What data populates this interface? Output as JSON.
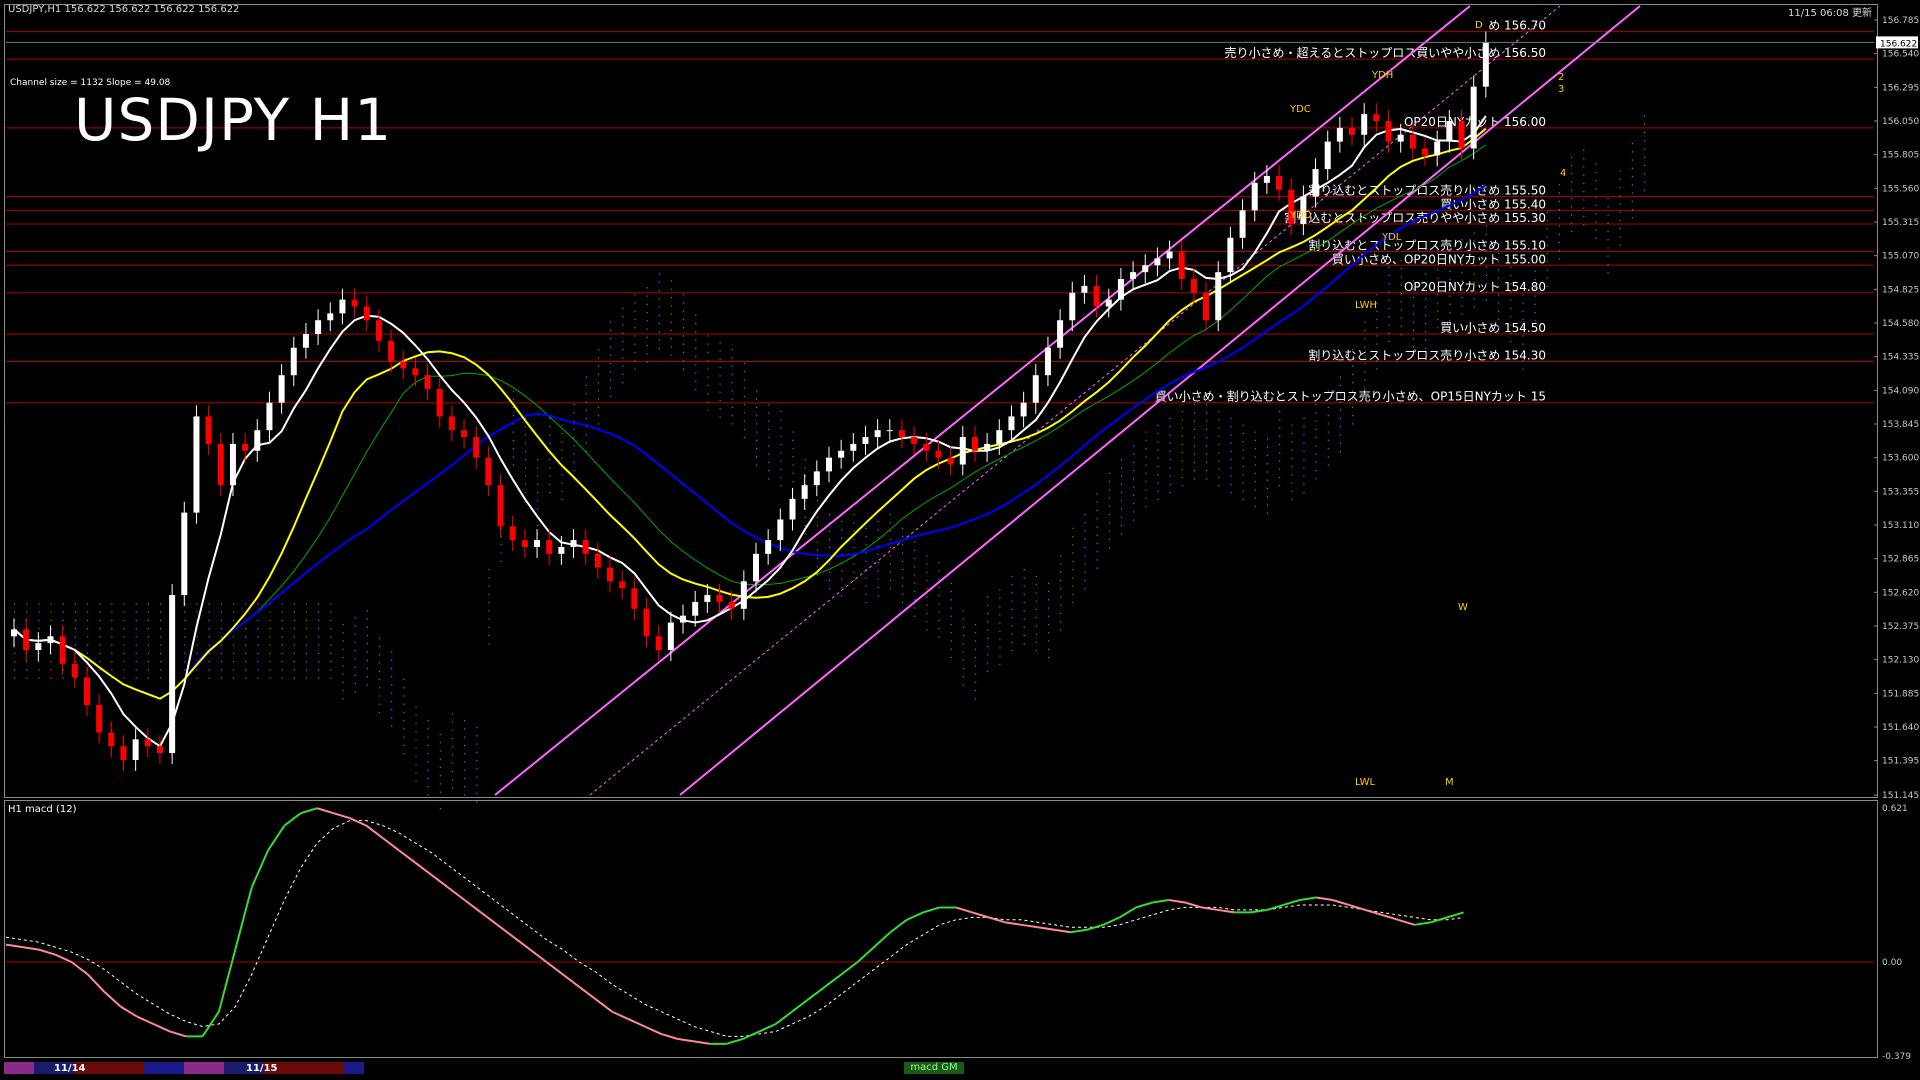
{
  "window": {
    "symbol_info": "USDJPY,H1  156.622 156.622 156.622 156.622",
    "clock": "11/15 06:08 更新",
    "big_title": "USDJPY H1",
    "channel_info": "Channel size = 1132  Slope = 49.08",
    "macd_label": "H1  macd (12)"
  },
  "bottom_tabs": [
    {
      "label": "11/14"
    },
    {
      "label": "11/15"
    }
  ],
  "macd_tab": "macd GM",
  "colors": {
    "background": "#000000",
    "bull_candle": "#ffffff",
    "bear_candle": "#ff0000",
    "ma_fast": "#ffffff",
    "ma_mid": "#ffff00",
    "ma_slow": "#0000ff",
    "channel": "#ff66ff",
    "level_line": "#b00000",
    "macd_rising": "#33dd33",
    "macd_falling": "#ff8899",
    "signal_line": "#ffffff"
  },
  "chart_data": [
    {
      "type": "candlestick",
      "title": "USDJPY H1",
      "ylim": [
        151.145,
        156.785
      ],
      "y_ticks": [
        "156.785",
        "156.540",
        "156.295",
        "156.050",
        "155.805",
        "155.560",
        "155.315",
        "155.070",
        "154.825",
        "154.580",
        "154.335",
        "154.090",
        "153.845",
        "153.600",
        "153.355",
        "153.110",
        "152.865",
        "152.620",
        "152.375",
        "152.130",
        "151.885",
        "151.640",
        "151.395",
        "151.145"
      ],
      "current_price": "156.622",
      "close": [
        152.35,
        152.2,
        152.25,
        152.3,
        152.1,
        152.0,
        151.8,
        151.6,
        151.5,
        151.4,
        151.55,
        151.5,
        151.45,
        152.6,
        153.2,
        153.9,
        153.7,
        153.4,
        153.7,
        153.65,
        153.8,
        154.0,
        154.2,
        154.4,
        154.5,
        154.6,
        154.65,
        154.75,
        154.7,
        154.6,
        154.45,
        154.3,
        154.25,
        154.2,
        154.1,
        153.9,
        153.8,
        153.75,
        153.6,
        153.4,
        153.1,
        153.0,
        152.95,
        153.0,
        152.9,
        152.95,
        153.0,
        152.9,
        152.8,
        152.7,
        152.65,
        152.5,
        152.3,
        152.2,
        152.4,
        152.45,
        152.55,
        152.6,
        152.55,
        152.5,
        152.7,
        152.9,
        153.0,
        153.15,
        153.3,
        153.4,
        153.5,
        153.6,
        153.65,
        153.7,
        153.75,
        153.8,
        153.8,
        153.75,
        153.7,
        153.65,
        153.6,
        153.55,
        153.75,
        153.65,
        153.7,
        153.8,
        153.9,
        154.0,
        154.2,
        154.4,
        154.6,
        154.8,
        154.85,
        154.7,
        154.75,
        154.9,
        154.95,
        155.0,
        155.05,
        155.1,
        154.9,
        154.8,
        154.6,
        154.95,
        155.2,
        155.4,
        155.6,
        155.65,
        155.55,
        155.3,
        155.5,
        155.7,
        155.9,
        156.0,
        155.95,
        156.1,
        156.05,
        155.9,
        155.95,
        155.85,
        155.8,
        155.9,
        156.05,
        155.85,
        156.3,
        156.62
      ],
      "levels": [
        {
          "price": 156.7,
          "label": "め 156.70"
        },
        {
          "price": 156.5,
          "label": "売り小さめ・超えるとストップロス買いやや小さめ 156.50"
        },
        {
          "price": 156.0,
          "label": "OP20日NYカット 156.00"
        },
        {
          "price": 155.5,
          "label": "割り込むとストップロス売り小さめ 155.50"
        },
        {
          "price": 155.4,
          "label": "買い小さめ 155.40"
        },
        {
          "price": 155.3,
          "label": "割り込むとストップロス売りやや小さめ 155.30"
        },
        {
          "price": 155.1,
          "label": "割り込むとストップロス売り小さめ 155.10"
        },
        {
          "price": 155.0,
          "label": "買い小さめ、OP20日NYカット 155.00"
        },
        {
          "price": 154.8,
          "label": "OP20日NYカット 154.80"
        },
        {
          "price": 154.5,
          "label": "買い小さめ 154.50"
        },
        {
          "price": 154.3,
          "label": "割り込むとストップロス売り小さめ 154.30"
        },
        {
          "price": 154.0,
          "label": "買い小さめ・割り込むとストップロス売り小さめ、OP15日NYカット 15"
        }
      ],
      "markers": [
        "YDH",
        "YDC",
        "YDO",
        "YDL",
        "LWH",
        "LWL",
        "W",
        "D",
        "M",
        "2",
        "3",
        "4"
      ]
    },
    {
      "type": "line",
      "title": "macd (12)",
      "ylim": [
        -0.379,
        0.621
      ],
      "y_ticks": [
        "0.621",
        "0.00",
        "-0.379"
      ],
      "macd": [
        0.07,
        0.06,
        0.05,
        0.03,
        0.0,
        -0.05,
        -0.12,
        -0.18,
        -0.22,
        -0.25,
        -0.28,
        -0.3,
        -0.3,
        -0.2,
        0.05,
        0.3,
        0.45,
        0.55,
        0.6,
        0.62,
        0.6,
        0.58,
        0.55,
        0.5,
        0.45,
        0.4,
        0.35,
        0.3,
        0.25,
        0.2,
        0.15,
        0.1,
        0.05,
        0.0,
        -0.05,
        -0.1,
        -0.15,
        -0.2,
        -0.23,
        -0.26,
        -0.29,
        -0.31,
        -0.32,
        -0.33,
        -0.33,
        -0.31,
        -0.28,
        -0.25,
        -0.2,
        -0.15,
        -0.1,
        -0.05,
        0.0,
        0.06,
        0.12,
        0.17,
        0.2,
        0.22,
        0.22,
        0.2,
        0.18,
        0.16,
        0.15,
        0.14,
        0.13,
        0.12,
        0.13,
        0.15,
        0.18,
        0.22,
        0.24,
        0.25,
        0.24,
        0.22,
        0.21,
        0.2,
        0.2,
        0.21,
        0.23,
        0.25,
        0.26,
        0.25,
        0.23,
        0.21,
        0.19,
        0.17,
        0.15,
        0.16,
        0.18,
        0.2
      ],
      "signal": [
        0.1,
        0.09,
        0.08,
        0.06,
        0.04,
        0.01,
        -0.03,
        -0.08,
        -0.13,
        -0.17,
        -0.21,
        -0.24,
        -0.26,
        -0.25,
        -0.18,
        -0.05,
        0.1,
        0.25,
        0.38,
        0.48,
        0.54,
        0.57,
        0.57,
        0.55,
        0.52,
        0.48,
        0.44,
        0.39,
        0.34,
        0.29,
        0.24,
        0.19,
        0.14,
        0.09,
        0.05,
        0.0,
        -0.04,
        -0.09,
        -0.13,
        -0.17,
        -0.2,
        -0.23,
        -0.26,
        -0.28,
        -0.3,
        -0.3,
        -0.29,
        -0.28,
        -0.25,
        -0.22,
        -0.18,
        -0.13,
        -0.08,
        -0.03,
        0.02,
        0.07,
        0.11,
        0.15,
        0.17,
        0.18,
        0.18,
        0.17,
        0.17,
        0.16,
        0.15,
        0.14,
        0.14,
        0.14,
        0.15,
        0.17,
        0.19,
        0.21,
        0.22,
        0.22,
        0.22,
        0.21,
        0.21,
        0.21,
        0.22,
        0.23,
        0.23,
        0.23,
        0.22,
        0.21,
        0.2,
        0.19,
        0.18,
        0.17,
        0.17,
        0.18
      ]
    }
  ]
}
